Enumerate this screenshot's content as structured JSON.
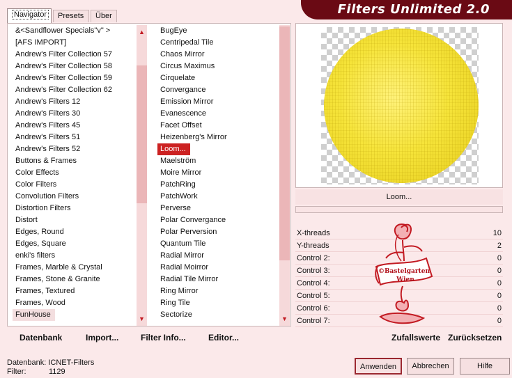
{
  "title": "Filters Unlimited 2.0",
  "tabs": [
    "Navigator",
    "Presets",
    "Über"
  ],
  "categories": [
    "&<Sandflower Specials\"v\" >",
    "[AFS IMPORT]",
    "Andrew's Filter Collection 57",
    "Andrew's Filter Collection 58",
    "Andrew's Filter Collection 59",
    "Andrew's Filter Collection 62",
    "Andrew's Filters 12",
    "Andrew's Filters 30",
    "Andrew's Filters 45",
    "Andrew's Filters 51",
    "Andrew's Filters 52",
    "Buttons & Frames",
    "Color Effects",
    "Color Filters",
    "Convolution Filters",
    "Distortion Filters",
    "Distort",
    "Edges, Round",
    "Edges, Square",
    "enki's filters",
    "Frames, Marble & Crystal",
    "Frames, Stone & Granite",
    "Frames, Textured",
    "Frames, Wood",
    "FunHouse"
  ],
  "selected_category": "FunHouse",
  "filters": [
    "BugEye",
    "Centripedal Tile",
    "Chaos Mirror",
    "Circus Maximus",
    "Cirquelate",
    "Convergance",
    "Emission Mirror",
    "Evanescence",
    "Facet Offset",
    "Heizenberg's Mirror",
    "Loom...",
    "Maelström",
    "Moire Mirror",
    "PatchRing",
    "PatchWork",
    "Perverse",
    "Polar Convergance",
    "Polar Perversion",
    "Quantum Tile",
    "Radial Mirror",
    "Radial Moirror",
    "Radial Tile Mirror",
    "Ring Mirror",
    "Ring Tile",
    "Sectorize"
  ],
  "selected_filter": "Loom...",
  "preview_label": "Loom...",
  "controls": [
    {
      "label": "X-threads",
      "value": "10"
    },
    {
      "label": "Y-threads",
      "value": "2"
    },
    {
      "label": "Control 2:",
      "value": "0"
    },
    {
      "label": "Control 3:",
      "value": "0"
    },
    {
      "label": "Control 4:",
      "value": "0"
    },
    {
      "label": "Control 5:",
      "value": "0"
    },
    {
      "label": "Control 6:",
      "value": "0"
    },
    {
      "label": "Control 7:",
      "value": "0"
    }
  ],
  "logo_text": {
    "line1": "©Bastelgarten",
    "line2": "Wien"
  },
  "footer": {
    "database": "Datenbank",
    "import": "Import...",
    "filter_info": "Filter Info...",
    "editor": "Editor...",
    "random": "Zufallswerte",
    "reset": "Zurücksetzen"
  },
  "status": {
    "db_label": "Datenbank:",
    "db_value": "ICNET-Filters",
    "filter_label": "Filter:",
    "filter_value": "1129"
  },
  "buttons": {
    "apply": "Anwenden",
    "cancel": "Abbrechen",
    "help": "Hilfe"
  },
  "colors": {
    "accent": "#6a0a14",
    "selection": "#cc2222",
    "background": "#fbe9ea",
    "preview_fill": "#f6e43a"
  }
}
